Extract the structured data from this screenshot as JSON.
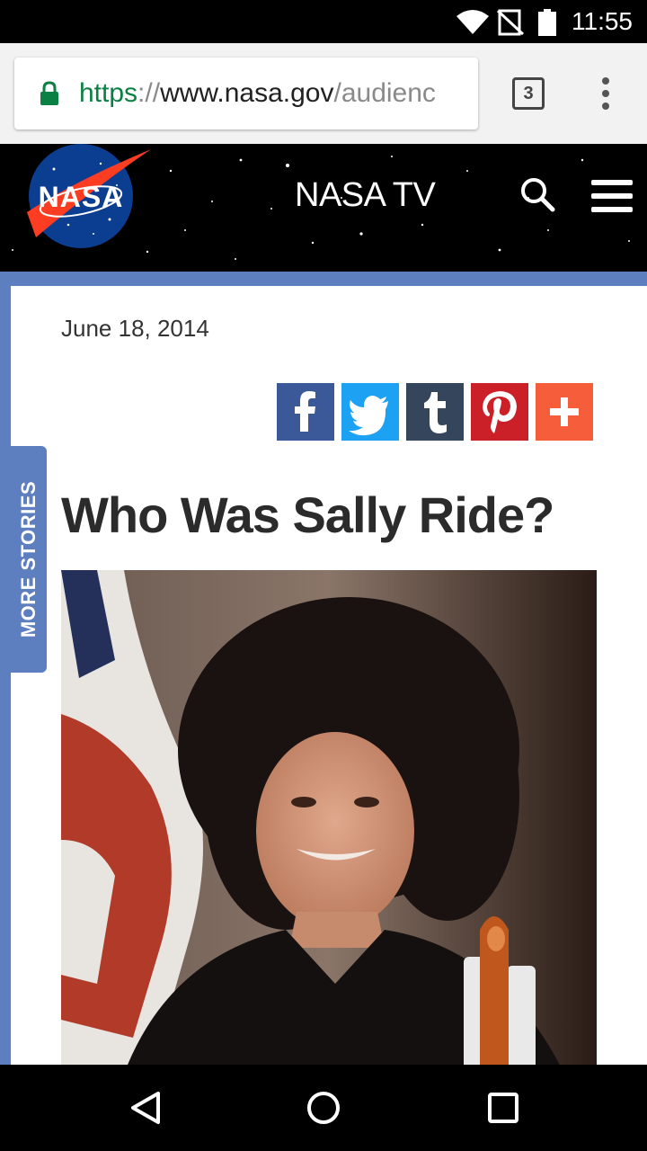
{
  "status_bar": {
    "time": "11:55"
  },
  "browser": {
    "url_scheme": "https",
    "url_separator": "://",
    "url_host": "www.nasa.gov",
    "url_path": "/audienc",
    "tab_count": "3"
  },
  "site_header": {
    "logo_text": "NASA",
    "title": "NASA TV"
  },
  "article": {
    "date": "June 18, 2014",
    "title": "Who Was Sally Ride?",
    "share_buttons": [
      {
        "name": "facebook",
        "glyph": "f",
        "color": "#3b5998"
      },
      {
        "name": "twitter",
        "color": "#1da1f2"
      },
      {
        "name": "tumblr",
        "glyph": "t",
        "color": "#35465c"
      },
      {
        "name": "pinterest",
        "color": "#cb2027"
      },
      {
        "name": "more",
        "glyph": "+",
        "color": "#f65e3b"
      }
    ]
  },
  "more_stories_label": "MORE STORIES",
  "colors": {
    "accent_blue": "#5d7fbf",
    "nasa_blue": "#0b3d91",
    "nasa_red": "#fc3d21",
    "secure_green": "#0b8043"
  }
}
